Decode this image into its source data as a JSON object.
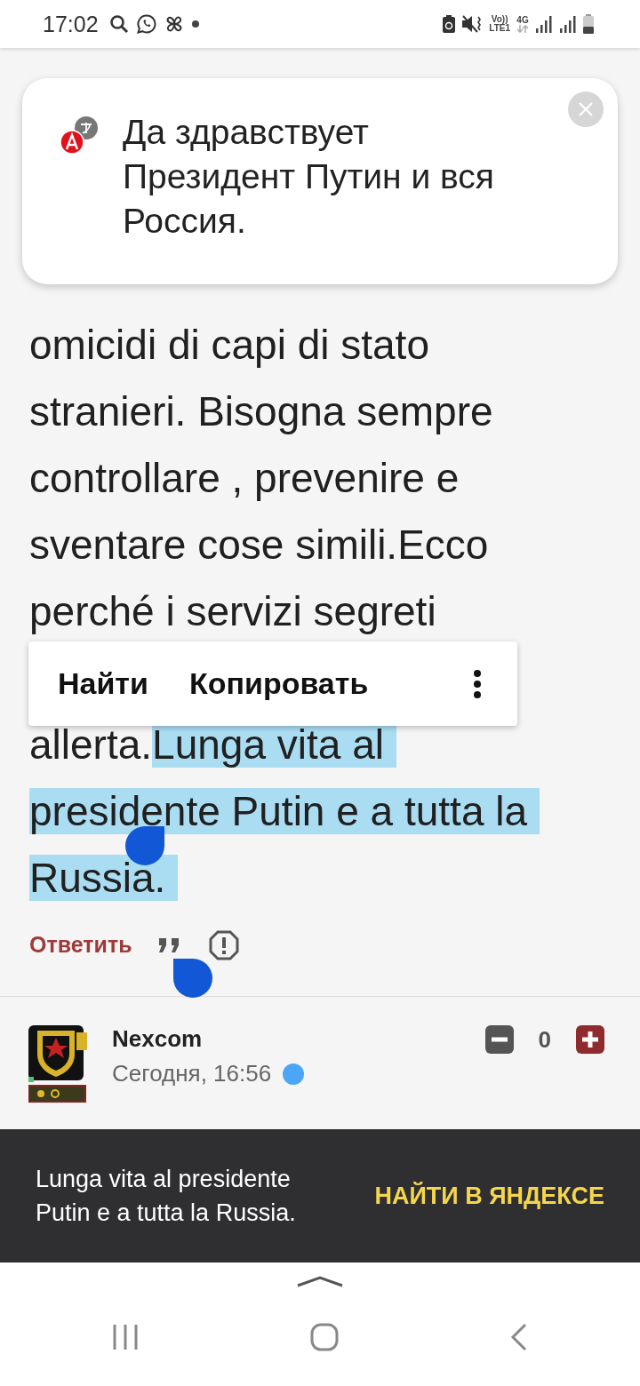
{
  "status_bar": {
    "time": "17:02",
    "volte": "Vo))",
    "lte": "LTE1",
    "network": "4G"
  },
  "article": {
    "lines": [
      {
        "segments": [
          {
            "text": "omicidi di capi di stato",
            "selected": false
          }
        ]
      },
      {
        "segments": [
          {
            "text": "stranieri. Bisogna sempre",
            "selected": false
          }
        ]
      },
      {
        "segments": [
          {
            "text": "controllare , prevenire e",
            "selected": false
          }
        ]
      },
      {
        "segments": [
          {
            "text": "sventare cose simili.Ecco",
            "selected": false
          }
        ]
      },
      {
        "segments": [
          {
            "text": "perché i servizi segreti",
            "selected": false
          }
        ]
      },
      {
        "segments": [
          {
            "text": "allerta.",
            "selected": false
          },
          {
            "text": "Lunga vita al",
            "selected": true
          }
        ]
      },
      {
        "segments": [
          {
            "text": "presidente Putin e a tutta la",
            "selected": true
          }
        ]
      },
      {
        "segments": [
          {
            "text": "Russia.",
            "selected": true
          }
        ]
      }
    ]
  },
  "translation_popup": {
    "text": "Да здравствует Президент Путин и вся Россия."
  },
  "context_menu": {
    "items": [
      "Найти",
      "Копировать"
    ]
  },
  "comment_actions": {
    "reply": "Ответить"
  },
  "next_comment": {
    "author": "Nexcom",
    "time": "Сегодня, 16:56",
    "score": "0"
  },
  "search_bar": {
    "text": "Lunga vita al presidente Putin e a tutta la Russia.",
    "action": "НАЙТИ В ЯНДЕКСЕ"
  }
}
